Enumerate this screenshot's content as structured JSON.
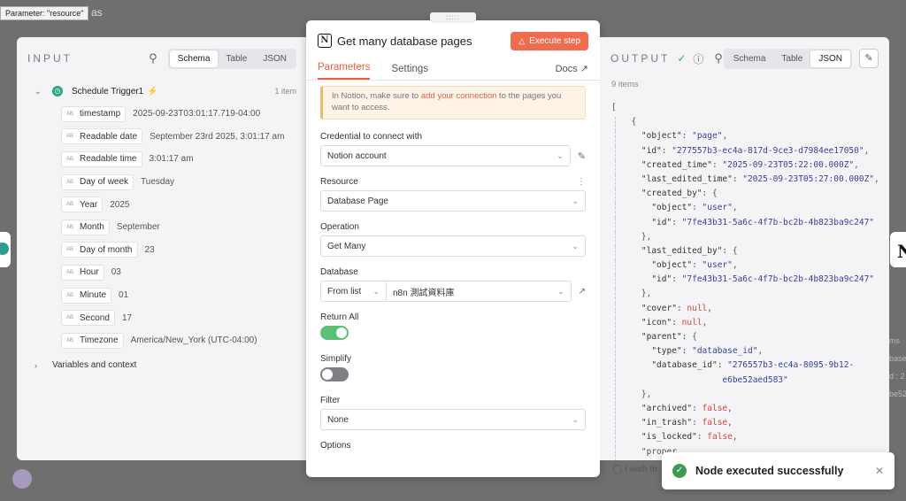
{
  "canvas": {
    "tooltip": "Parameter: \"resource\"",
    "title_fragment": "as"
  },
  "input": {
    "label": "INPUT",
    "tabs": [
      "Schema",
      "Table",
      "JSON"
    ],
    "active_tab": "Schema",
    "trigger": {
      "name": "Schedule Trigger1",
      "count": "1 item"
    },
    "fields": [
      {
        "key": "timestamp",
        "value": "2025-09-23T03:01:17.719-04:00"
      },
      {
        "key": "Readable date",
        "value": "September 23rd 2025, 3:01:17 am"
      },
      {
        "key": "Readable time",
        "value": "3:01:17 am"
      },
      {
        "key": "Day of week",
        "value": "Tuesday"
      },
      {
        "key": "Year",
        "value": "2025"
      },
      {
        "key": "Month",
        "value": "September"
      },
      {
        "key": "Day of month",
        "value": "23"
      },
      {
        "key": "Hour",
        "value": "03"
      },
      {
        "key": "Minute",
        "value": "01"
      },
      {
        "key": "Second",
        "value": "17"
      },
      {
        "key": "Timezone",
        "value": "America/New_York (UTC-04:00)"
      }
    ],
    "vars_label": "Variables and context"
  },
  "modal": {
    "title": "Get many database pages",
    "execute_label": "Execute step",
    "tabs": [
      "Parameters",
      "Settings"
    ],
    "docs_label": "Docs",
    "notice": {
      "prefix": "In Notion, make sure to ",
      "link": "add your connection",
      "suffix": " to the pages you want to access."
    },
    "credential": {
      "label": "Credential to connect with",
      "value": "Notion account"
    },
    "resource": {
      "label": "Resource",
      "value": "Database Page"
    },
    "operation": {
      "label": "Operation",
      "value": "Get Many"
    },
    "database": {
      "label": "Database",
      "mode": "From list",
      "value": "n8n 測試資料庫"
    },
    "return_all": {
      "label": "Return All",
      "state": "on"
    },
    "simplify": {
      "label": "Simplify",
      "state": "off"
    },
    "filter": {
      "label": "Filter",
      "value": "None"
    },
    "options_label": "Options"
  },
  "output": {
    "label": "OUTPUT",
    "tabs": [
      "Schema",
      "Table",
      "JSON"
    ],
    "active_tab": "JSON",
    "items_count": "9 items",
    "json_lines": [
      "[",
      "  {",
      "    \"object\": \"page\",",
      "    \"id\": \"277557b3-ec4a-817d-9ce3-d7984ee17050\",",
      "    \"created_time\": \"2025-09-23T05:22:00.000Z\",",
      "    \"last_edited_time\": \"2025-09-23T05:27:00.000Z\",",
      "    \"created_by\": {",
      "      \"object\": \"user\",",
      "      \"id\": \"7fe43b31-5a6c-4f7b-bc2b-4b823ba9c247\"",
      "    },",
      "    \"last_edited_by\": {",
      "      \"object\": \"user\",",
      "      \"id\": \"7fe43b31-5a6c-4f7b-bc2b-4b823ba9c247\"",
      "    },",
      "    \"cover\": null,",
      "    \"icon\": null,",
      "    \"parent\": {",
      "      \"type\": \"database_id\",",
      "      \"database_id\": \"276557b3-ec4a-8095-9b12-",
      "                    e6be52aed583\"",
      "    },",
      "    \"archived\": false,",
      "    \"in_trash\": false,",
      "    \"is_locked\": false,",
      "    \"proper"
    ],
    "wish_text": "I wish th"
  },
  "toast": {
    "message": "Node executed successfully"
  },
  "colors": {
    "accent": "#ef6d4f",
    "success": "#3e9a55",
    "toggle_on": "#5bc174"
  }
}
